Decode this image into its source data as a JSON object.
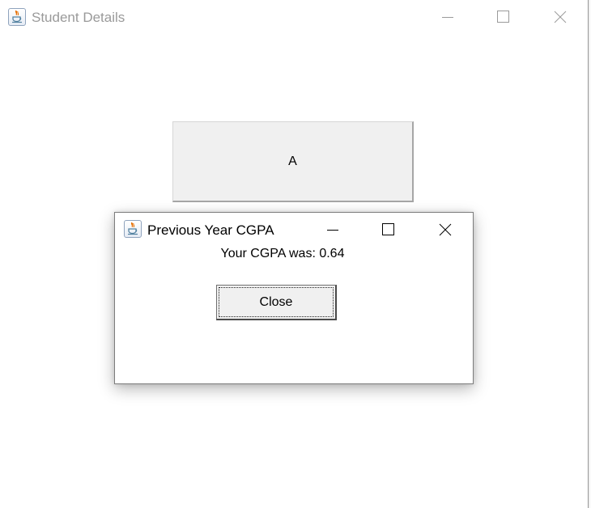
{
  "main_window": {
    "title": "Student Details",
    "button_a_label": "A",
    "icon": "java-coffee-cup-icon",
    "title_color": "#9a9a9a"
  },
  "dialog": {
    "title": "Previous Year CGPA",
    "message": "Your CGPA was: 0.64",
    "close_button_label": "Close",
    "icon": "java-coffee-cup-icon"
  },
  "colors": {
    "button_face": "#f0f0f0",
    "window_background": "#ffffff",
    "java_cup_orange": "#e76f00",
    "java_cup_blue": "#5382a1"
  }
}
